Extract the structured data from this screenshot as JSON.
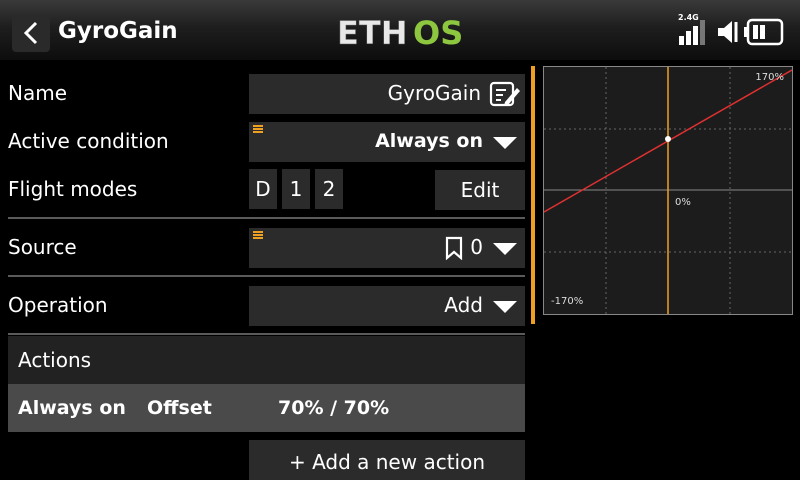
{
  "header": {
    "title": "GyroGain",
    "logo_text": "ETHOS",
    "radio_band": "2.4G"
  },
  "form": {
    "name": {
      "label": "Name",
      "value": "GyroGain"
    },
    "active_condition": {
      "label": "Active condition",
      "value": "Always on"
    },
    "flight_modes": {
      "label": "Flight modes",
      "modes": [
        "D",
        "1",
        "2"
      ],
      "edit_label": "Edit"
    },
    "source": {
      "label": "Source",
      "value": "0"
    },
    "operation": {
      "label": "Operation",
      "value": "Add"
    }
  },
  "actions": {
    "header": "Actions",
    "rows": [
      {
        "condition": "Always on",
        "type": "Offset",
        "value": "70% / 70%"
      }
    ],
    "add_label": "+ Add a new action"
  },
  "graph": {
    "max_label": "170%",
    "min_label": "-170%",
    "zero_label": "0%",
    "line_color": "#e03030",
    "cursor_color": "#f0a020"
  },
  "colors": {
    "accent": "#f0a020",
    "logo_os": "#8dc63f"
  }
}
